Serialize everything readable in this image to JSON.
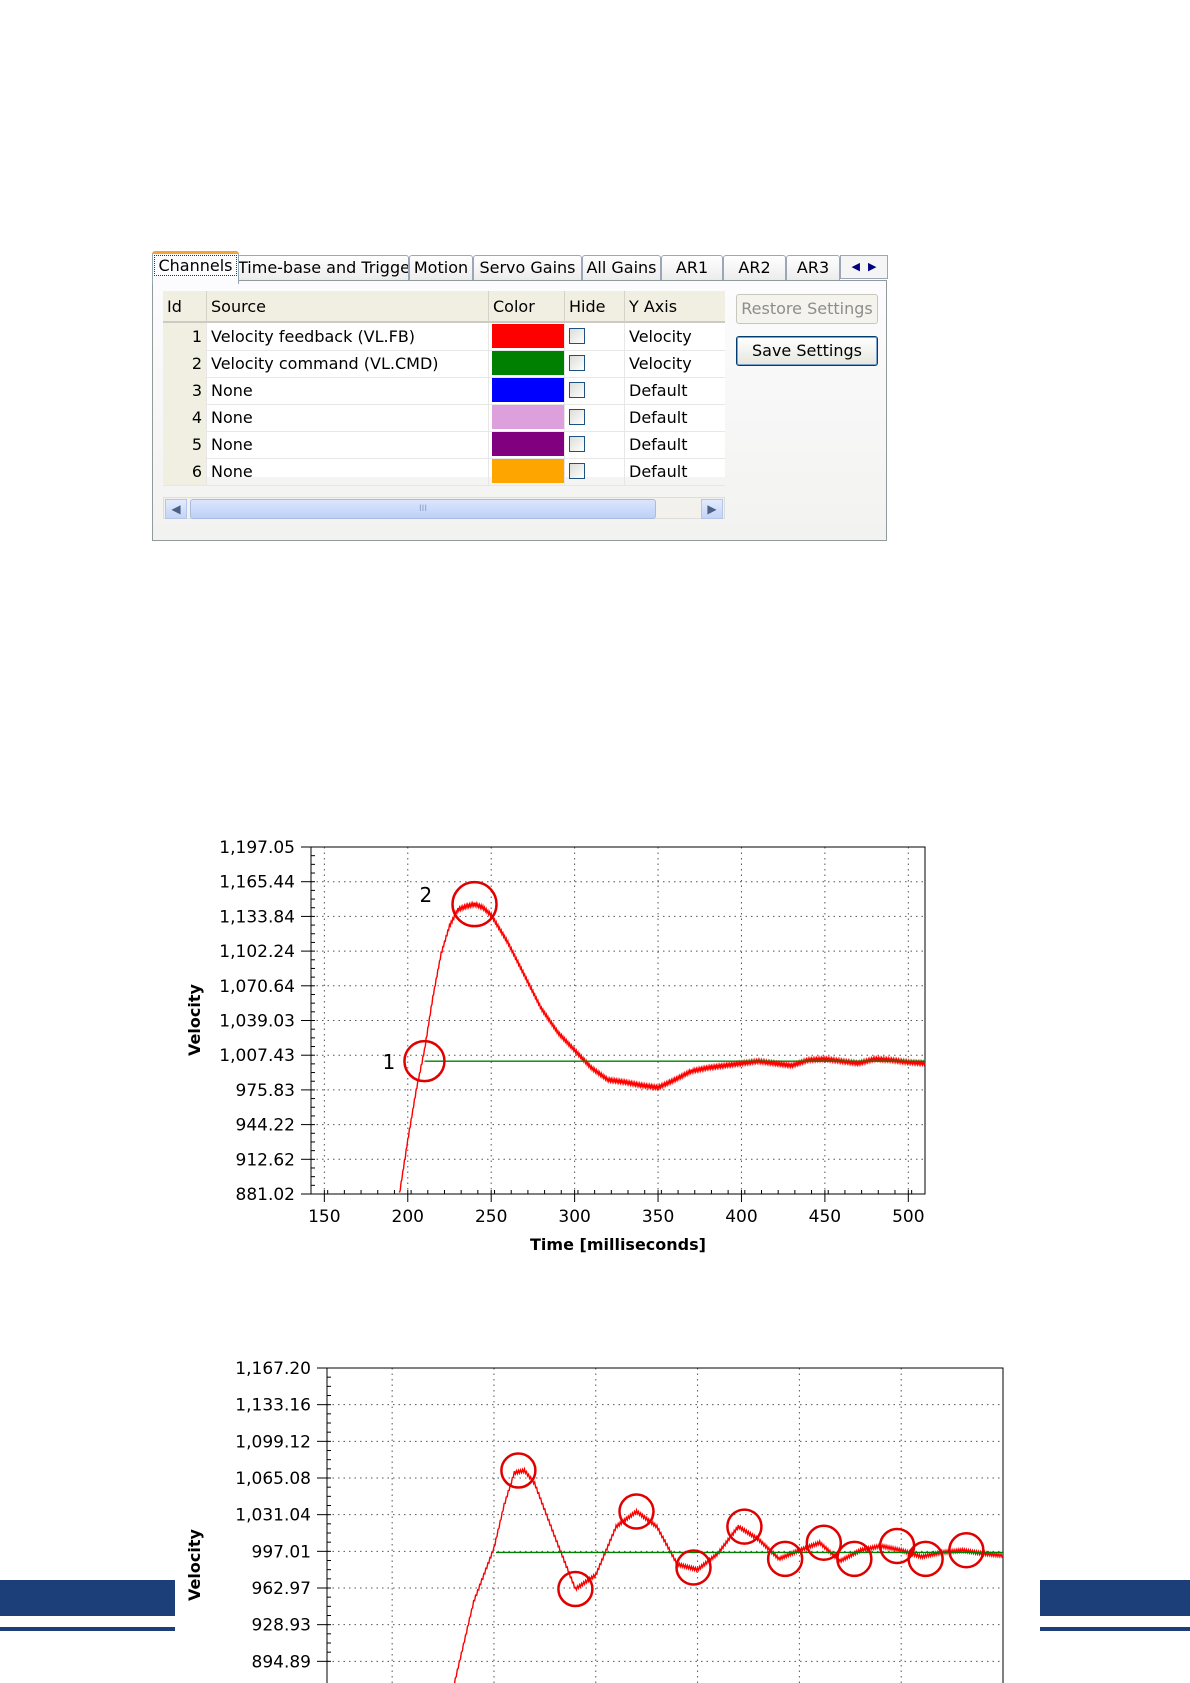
{
  "tabs": [
    "Channels",
    "Time-base and Trigger",
    "Motion",
    "Servo Gains",
    "All Gains",
    "AR1",
    "AR2",
    "AR3"
  ],
  "table": {
    "headers": [
      "Id",
      "Source",
      "Color",
      "Hide",
      "Y Axis"
    ],
    "rows": [
      {
        "id": "1",
        "source": "Velocity feedback (VL.FB)",
        "color": "#ff0000",
        "yaxis": "Velocity"
      },
      {
        "id": "2",
        "source": "Velocity command (VL.CMD)",
        "color": "#008000",
        "yaxis": "Velocity"
      },
      {
        "id": "3",
        "source": "None",
        "color": "#0000ff",
        "yaxis": "Default"
      },
      {
        "id": "4",
        "source": "None",
        "color": "#dda0dd",
        "yaxis": "Default"
      },
      {
        "id": "5",
        "source": "None",
        "color": "#800080",
        "yaxis": "Default"
      },
      {
        "id": "6",
        "source": "None",
        "color": "#ffa500",
        "yaxis": "Default"
      }
    ]
  },
  "buttons": {
    "restore": "Restore Settings",
    "save": "Save Settings"
  },
  "scroll_thumb": "III",
  "chart_data": [
    {
      "type": "line",
      "xlabel": "Time [milliseconds]",
      "ylabel": "Velocity",
      "xlim": [
        142,
        510
      ],
      "ylim": [
        881.02,
        1197.05
      ],
      "x_ticks": [
        "150",
        "200",
        "250",
        "300",
        "350",
        "400",
        "450",
        "500"
      ],
      "y_ticks": [
        "1,197.05",
        "1,165.44",
        "1,133.84",
        "1,102.24",
        "1,070.64",
        "1,039.03",
        "1,007.43",
        "975.83",
        "944.22",
        "912.62",
        "881.02"
      ],
      "annotations": [
        {
          "label": "1",
          "x": 210,
          "y": 1002
        },
        {
          "label": "2",
          "x": 240,
          "y": 1145
        }
      ],
      "series": [
        {
          "color": "#ff0000",
          "x": [
            195,
            200,
            205,
            210,
            215,
            220,
            225,
            230,
            235,
            240,
            245,
            250,
            260,
            270,
            280,
            290,
            300,
            310,
            320,
            330,
            340,
            350,
            360,
            370,
            380,
            390,
            400,
            410,
            420,
            430,
            440,
            450,
            460,
            470,
            480,
            490,
            500,
            510
          ],
          "values": [
            881,
            930,
            975,
            1012,
            1060,
            1100,
            1125,
            1140,
            1143,
            1145,
            1142,
            1135,
            1110,
            1080,
            1050,
            1028,
            1012,
            996,
            985,
            983,
            980,
            978,
            985,
            993,
            996,
            998,
            1000,
            1002,
            1000,
            998,
            1003,
            1004,
            1002,
            1000,
            1004,
            1003,
            1001,
            1000
          ]
        },
        {
          "color": "#008000",
          "x": [
            210,
            510
          ],
          "values": [
            1002,
            1002
          ]
        }
      ]
    },
    {
      "type": "line",
      "xlabel": "",
      "ylabel": "Velocity",
      "xlim": [
        168,
        500
      ],
      "ylim": [
        860.85,
        1167.2
      ],
      "x_ticks": [],
      "y_ticks": [
        "1,167.20",
        "1,133.16",
        "1,099.12",
        "1,065.08",
        "1,031.04",
        "997.01",
        "962.97",
        "928.93",
        "894.89"
      ],
      "series": [
        {
          "color": "#ff0000",
          "x": [
            230,
            240,
            250,
            255,
            260,
            265,
            270,
            280,
            290,
            300,
            310,
            320,
            330,
            340,
            350,
            360,
            370,
            380,
            390,
            400,
            410,
            420,
            430,
            440,
            450,
            460,
            470,
            480,
            490,
            500
          ],
          "values": [
            870,
            950,
            1000,
            1040,
            1070,
            1072,
            1060,
            1010,
            962,
            975,
            1020,
            1034,
            1020,
            985,
            980,
            995,
            1020,
            1008,
            990,
            998,
            1005,
            988,
            998,
            1002,
            998,
            992,
            996,
            998,
            995,
            993
          ]
        },
        {
          "color": "#008000",
          "x": [
            251,
            500
          ],
          "values": [
            996,
            996
          ]
        }
      ]
    }
  ]
}
